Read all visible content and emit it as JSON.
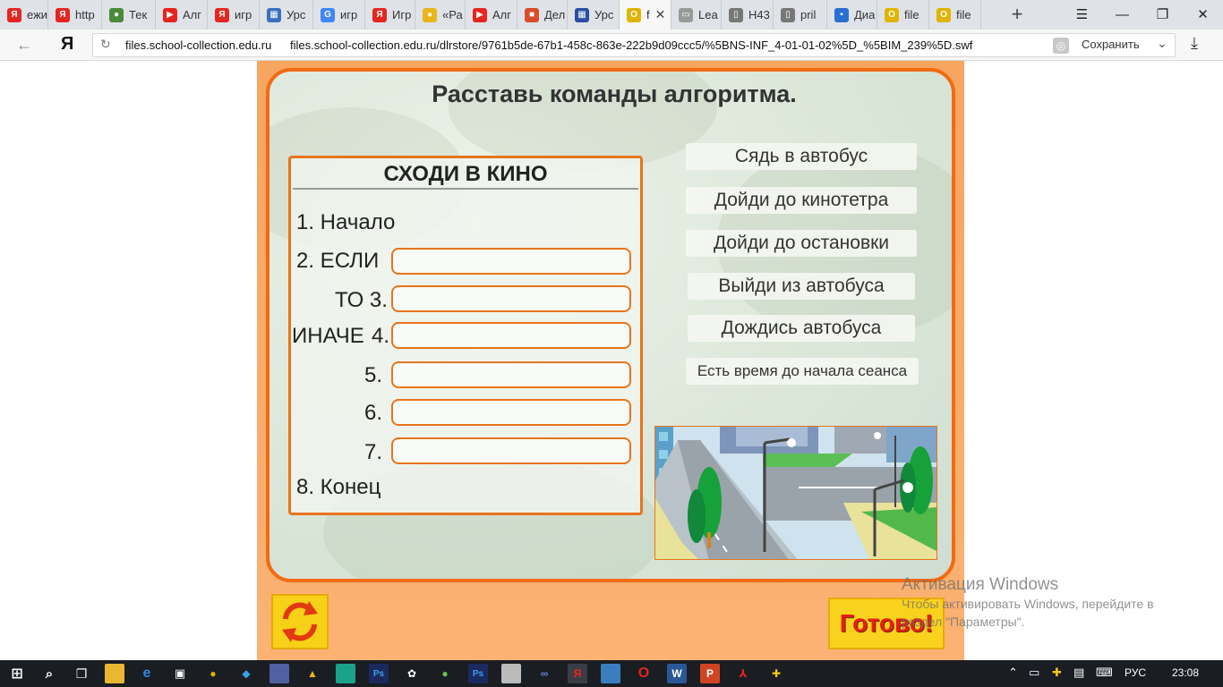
{
  "tabs": [
    {
      "label": "ежи",
      "icon": "yandex-icon",
      "color": "#e52620"
    },
    {
      "label": "http",
      "icon": "yandex-icon",
      "color": "#e52620"
    },
    {
      "label": "Тек",
      "icon": "globe-icon",
      "color": "#4a8a3a"
    },
    {
      "label": "Алг",
      "icon": "youtube-icon",
      "color": "#e52620"
    },
    {
      "label": "игр",
      "icon": "yandex-icon",
      "color": "#e52620"
    },
    {
      "label": "Урс",
      "icon": "presentation-icon",
      "color": "#3a6fbf"
    },
    {
      "label": "игр",
      "icon": "google-icon",
      "color": "#4285f4"
    },
    {
      "label": "Игр",
      "icon": "yandex-icon",
      "color": "#e52620"
    },
    {
      "label": "«Ра",
      "icon": "lemon-icon",
      "color": "#e8b619"
    },
    {
      "label": "Алг",
      "icon": "play-icon",
      "color": "#e52620"
    },
    {
      "label": "Дел",
      "icon": "game-icon",
      "color": "#d94c2a"
    },
    {
      "label": "Урс",
      "icon": "matrix-icon",
      "color": "#2a4fa0"
    },
    {
      "label": "f",
      "icon": "ring-icon",
      "color": "#e0b400"
    },
    {
      "label": "Lea",
      "icon": "board-icon",
      "color": "#999999"
    },
    {
      "label": "Н43",
      "icon": "document-icon",
      "color": "#777777"
    },
    {
      "label": "pril",
      "icon": "document-icon",
      "color": "#777777"
    },
    {
      "label": "Диа",
      "icon": "chat-icon",
      "color": "#2a6fd0"
    },
    {
      "label": "file",
      "icon": "ring-icon",
      "color": "#e0b400"
    },
    {
      "label": "file",
      "icon": "ring-icon",
      "color": "#e0b400"
    }
  ],
  "address": {
    "domain": "files.school-collection.edu.ru",
    "url": "files.school-collection.edu.ru/dlrstore/9761b5de-67b1-458c-863e-222b9d09ccc5/%5BNS-INF_4-01-01-02%5D_%5BIM_239%5D.swf",
    "save_label": "Сохранить",
    "logo": "Я"
  },
  "task": {
    "title": "Расставь команды алгоритма.",
    "card_title": "СХОДИ В КИНО",
    "steps": {
      "s1": "1. Начало",
      "s2": "2. ЕСЛИ",
      "s3": "ТО 3.",
      "s4a": "ИНАЧЕ",
      "s4b": "4.",
      "s5": "5.",
      "s6": "6.",
      "s7": "7.",
      "s8": "8. Конец"
    },
    "commands": [
      "Сядь в автобус",
      "Дойди до кинотетра",
      "Дойди до остановки",
      "Выйди из автобуса",
      "Дождись автобуса",
      "Есть время до начала сеанса"
    ],
    "done_label": "Готово!"
  },
  "watermark": {
    "title": "Активация Windows",
    "line1": "Чтобы активировать Windows, перейдите в",
    "line2": "раздел \"Параметры\"."
  },
  "tray": {
    "lang": "РУС",
    "time": "23:08"
  },
  "colors": {
    "accent_orange": "#f26a12",
    "done_text": "#e61e14",
    "button_yellow": "#f9d21d"
  }
}
